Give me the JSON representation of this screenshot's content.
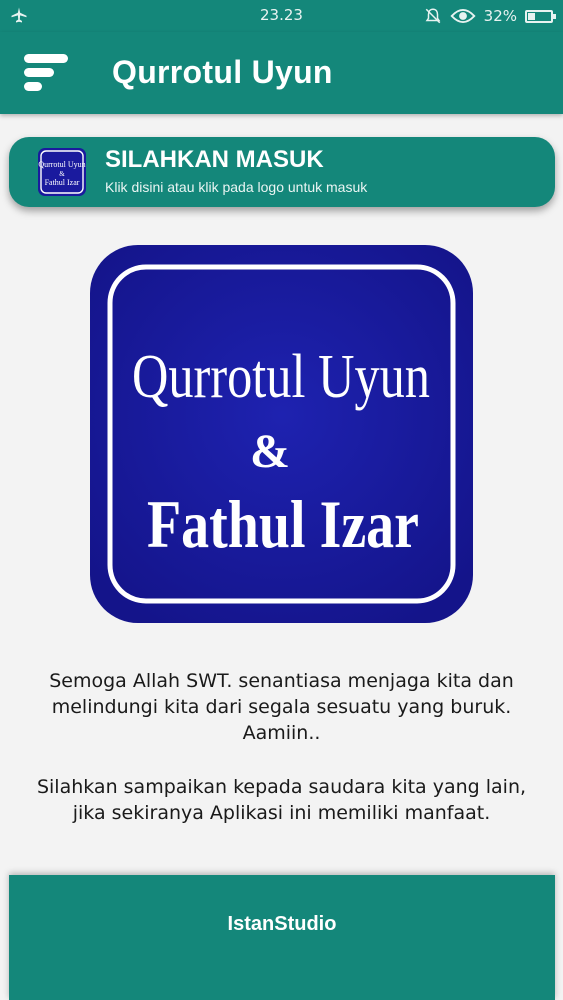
{
  "status_bar": {
    "time": "23.23",
    "battery": "32%",
    "battery_level": 0.32,
    "icons": [
      "airplane-icon",
      "mute-icon",
      "eye-icon",
      "battery-icon"
    ]
  },
  "app_bar": {
    "title": "Qurrotul Uyun",
    "menu_icon": "menu-icon"
  },
  "login_card": {
    "heading": "SILAHKAN MASUK",
    "subtitle": "Klik disini atau klik pada logo untuk masuk",
    "logo_lines": [
      "Qurrotul Uyun",
      "&",
      "Fathul Izar"
    ]
  },
  "logo": {
    "line1": "Qurrotul Uyun",
    "line2": "&",
    "line3": "Fathul Izar"
  },
  "message": {
    "line1": "Semoga Allah SWT. senantiasa menjaga kita dan",
    "line2": "melindungi kita dari segala sesuatu yang buruk.",
    "line3": "Aamiin..",
    "line4": "Silahkan sampaikan kepada saudara kita yang lain,",
    "line5": "jika sekiranya Aplikasi ini memiliki manfaat."
  },
  "footer": {
    "credit": "IstanStudio"
  },
  "colors": {
    "primary": "#14877a",
    "logo_blue": "#1a1a9e",
    "background": "#f3f3f3"
  }
}
